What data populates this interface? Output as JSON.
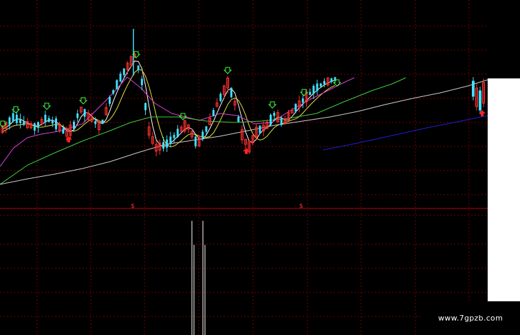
{
  "watermark": {
    "text": "www.7gpzb.com"
  },
  "colors": {
    "background": "#000000",
    "grid": "#7a0000",
    "divider": "#c00000",
    "up": "#ff3030",
    "down": "#40e0ff",
    "ma5": "#ffffff",
    "ma10": "#e8e040",
    "ma20": "#e040e0",
    "ma60": "#40d040",
    "ma120": "#d0d0d0",
    "ma250": "#2020d0",
    "buy_arrow": "#40ff40",
    "sell_arrow": "#ff2020",
    "signal": "#ffffff"
  },
  "chart_data": {
    "type": "candlestick",
    "panels": [
      "price",
      "indicator"
    ],
    "markers": {
      "dollar_signs": [
        "$",
        "$"
      ]
    },
    "series_lines": [
      "MA5",
      "MA10",
      "MA20",
      "MA60",
      "MA120",
      "MA250"
    ],
    "indicator": {
      "spikes": 2
    }
  }
}
